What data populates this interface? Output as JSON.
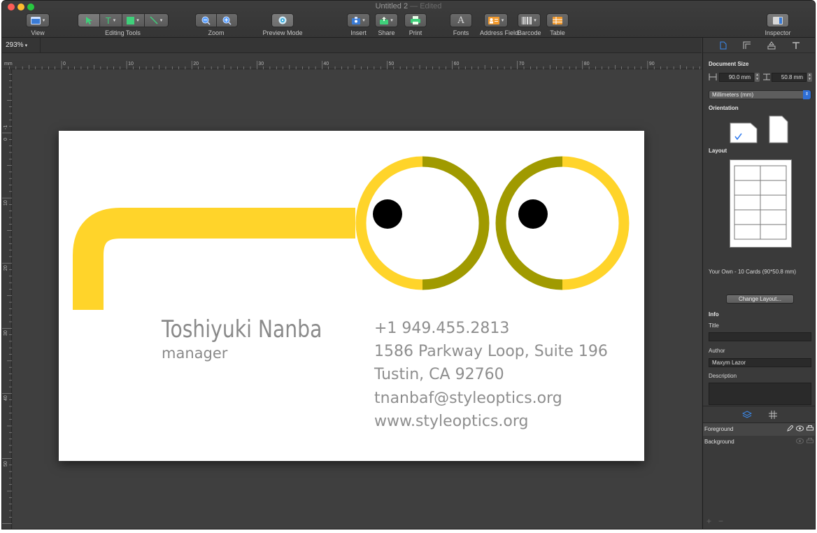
{
  "window": {
    "title": "Untitled 2",
    "status": "Edited",
    "separator": "—"
  },
  "toolbar": {
    "view": "View",
    "editing_tools": "Editing Tools",
    "zoom": "Zoom",
    "preview_mode": "Preview Mode",
    "insert": "Insert",
    "share": "Share",
    "print": "Print",
    "fonts": "Fonts",
    "address_field": "Address Field",
    "barcode": "Barcode",
    "table": "Table",
    "inspector": "Inspector"
  },
  "zoom_level": "293%",
  "ruler": {
    "unit": "mm",
    "h_ticks": [
      "0",
      "10",
      "20",
      "30",
      "40",
      "50",
      "60",
      "70",
      "80",
      "90"
    ],
    "v_ticks": [
      "-1",
      "0",
      "10",
      "20",
      "30",
      "40",
      "50"
    ]
  },
  "card": {
    "name": "Toshiyuki Nanba",
    "role": "manager",
    "phone": "+1 949.455.2813",
    "address_line1": "1586 Parkway Loop, Suite 196",
    "address_line2": "Tustin, CA 92760",
    "email": "tnanbaf@styleoptics.org",
    "website": "www.styleoptics.org",
    "colors": {
      "yellow": "#FFD42A",
      "olive": "#A09A00",
      "pupil": "#000000",
      "text": "#8C8C8C"
    }
  },
  "inspector": {
    "document_size": "Document Size",
    "width": "90.0 mm",
    "height": "50.8 mm",
    "units": "Millimeters (mm)",
    "orientation": "Orientation",
    "layout": "Layout",
    "layout_name": "Your Own - 10 Cards (90*50.8 mm)",
    "change_layout": "Change Layout...",
    "info": "Info",
    "title_label": "Title",
    "title_value": "",
    "author_label": "Author",
    "author_value": "Maxym Lazor",
    "description_label": "Description",
    "description_value": "",
    "layers": [
      "Foreground",
      "Background"
    ]
  }
}
